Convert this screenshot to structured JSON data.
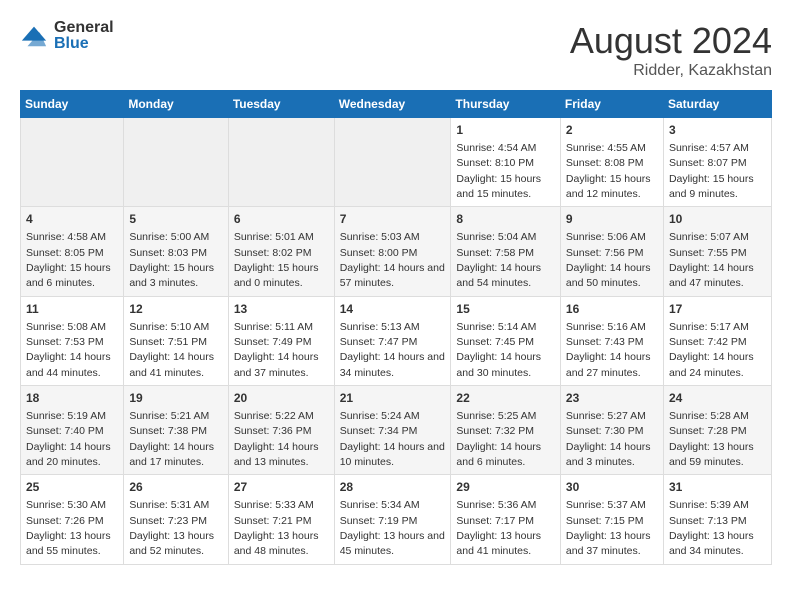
{
  "logo": {
    "general": "General",
    "blue": "Blue"
  },
  "title": {
    "month_year": "August 2024",
    "location": "Ridder, Kazakhstan"
  },
  "days_of_week": [
    "Sunday",
    "Monday",
    "Tuesday",
    "Wednesday",
    "Thursday",
    "Friday",
    "Saturday"
  ],
  "weeks": [
    [
      {
        "day": "",
        "sunrise": "",
        "sunset": "",
        "daylight": ""
      },
      {
        "day": "",
        "sunrise": "",
        "sunset": "",
        "daylight": ""
      },
      {
        "day": "",
        "sunrise": "",
        "sunset": "",
        "daylight": ""
      },
      {
        "day": "",
        "sunrise": "",
        "sunset": "",
        "daylight": ""
      },
      {
        "day": "1",
        "sunrise": "Sunrise: 4:54 AM",
        "sunset": "Sunset: 8:10 PM",
        "daylight": "Daylight: 15 hours and 15 minutes."
      },
      {
        "day": "2",
        "sunrise": "Sunrise: 4:55 AM",
        "sunset": "Sunset: 8:08 PM",
        "daylight": "Daylight: 15 hours and 12 minutes."
      },
      {
        "day": "3",
        "sunrise": "Sunrise: 4:57 AM",
        "sunset": "Sunset: 8:07 PM",
        "daylight": "Daylight: 15 hours and 9 minutes."
      }
    ],
    [
      {
        "day": "4",
        "sunrise": "Sunrise: 4:58 AM",
        "sunset": "Sunset: 8:05 PM",
        "daylight": "Daylight: 15 hours and 6 minutes."
      },
      {
        "day": "5",
        "sunrise": "Sunrise: 5:00 AM",
        "sunset": "Sunset: 8:03 PM",
        "daylight": "Daylight: 15 hours and 3 minutes."
      },
      {
        "day": "6",
        "sunrise": "Sunrise: 5:01 AM",
        "sunset": "Sunset: 8:02 PM",
        "daylight": "Daylight: 15 hours and 0 minutes."
      },
      {
        "day": "7",
        "sunrise": "Sunrise: 5:03 AM",
        "sunset": "Sunset: 8:00 PM",
        "daylight": "Daylight: 14 hours and 57 minutes."
      },
      {
        "day": "8",
        "sunrise": "Sunrise: 5:04 AM",
        "sunset": "Sunset: 7:58 PM",
        "daylight": "Daylight: 14 hours and 54 minutes."
      },
      {
        "day": "9",
        "sunrise": "Sunrise: 5:06 AM",
        "sunset": "Sunset: 7:56 PM",
        "daylight": "Daylight: 14 hours and 50 minutes."
      },
      {
        "day": "10",
        "sunrise": "Sunrise: 5:07 AM",
        "sunset": "Sunset: 7:55 PM",
        "daylight": "Daylight: 14 hours and 47 minutes."
      }
    ],
    [
      {
        "day": "11",
        "sunrise": "Sunrise: 5:08 AM",
        "sunset": "Sunset: 7:53 PM",
        "daylight": "Daylight: 14 hours and 44 minutes."
      },
      {
        "day": "12",
        "sunrise": "Sunrise: 5:10 AM",
        "sunset": "Sunset: 7:51 PM",
        "daylight": "Daylight: 14 hours and 41 minutes."
      },
      {
        "day": "13",
        "sunrise": "Sunrise: 5:11 AM",
        "sunset": "Sunset: 7:49 PM",
        "daylight": "Daylight: 14 hours and 37 minutes."
      },
      {
        "day": "14",
        "sunrise": "Sunrise: 5:13 AM",
        "sunset": "Sunset: 7:47 PM",
        "daylight": "Daylight: 14 hours and 34 minutes."
      },
      {
        "day": "15",
        "sunrise": "Sunrise: 5:14 AM",
        "sunset": "Sunset: 7:45 PM",
        "daylight": "Daylight: 14 hours and 30 minutes."
      },
      {
        "day": "16",
        "sunrise": "Sunrise: 5:16 AM",
        "sunset": "Sunset: 7:43 PM",
        "daylight": "Daylight: 14 hours and 27 minutes."
      },
      {
        "day": "17",
        "sunrise": "Sunrise: 5:17 AM",
        "sunset": "Sunset: 7:42 PM",
        "daylight": "Daylight: 14 hours and 24 minutes."
      }
    ],
    [
      {
        "day": "18",
        "sunrise": "Sunrise: 5:19 AM",
        "sunset": "Sunset: 7:40 PM",
        "daylight": "Daylight: 14 hours and 20 minutes."
      },
      {
        "day": "19",
        "sunrise": "Sunrise: 5:21 AM",
        "sunset": "Sunset: 7:38 PM",
        "daylight": "Daylight: 14 hours and 17 minutes."
      },
      {
        "day": "20",
        "sunrise": "Sunrise: 5:22 AM",
        "sunset": "Sunset: 7:36 PM",
        "daylight": "Daylight: 14 hours and 13 minutes."
      },
      {
        "day": "21",
        "sunrise": "Sunrise: 5:24 AM",
        "sunset": "Sunset: 7:34 PM",
        "daylight": "Daylight: 14 hours and 10 minutes."
      },
      {
        "day": "22",
        "sunrise": "Sunrise: 5:25 AM",
        "sunset": "Sunset: 7:32 PM",
        "daylight": "Daylight: 14 hours and 6 minutes."
      },
      {
        "day": "23",
        "sunrise": "Sunrise: 5:27 AM",
        "sunset": "Sunset: 7:30 PM",
        "daylight": "Daylight: 14 hours and 3 minutes."
      },
      {
        "day": "24",
        "sunrise": "Sunrise: 5:28 AM",
        "sunset": "Sunset: 7:28 PM",
        "daylight": "Daylight: 13 hours and 59 minutes."
      }
    ],
    [
      {
        "day": "25",
        "sunrise": "Sunrise: 5:30 AM",
        "sunset": "Sunset: 7:26 PM",
        "daylight": "Daylight: 13 hours and 55 minutes."
      },
      {
        "day": "26",
        "sunrise": "Sunrise: 5:31 AM",
        "sunset": "Sunset: 7:23 PM",
        "daylight": "Daylight: 13 hours and 52 minutes."
      },
      {
        "day": "27",
        "sunrise": "Sunrise: 5:33 AM",
        "sunset": "Sunset: 7:21 PM",
        "daylight": "Daylight: 13 hours and 48 minutes."
      },
      {
        "day": "28",
        "sunrise": "Sunrise: 5:34 AM",
        "sunset": "Sunset: 7:19 PM",
        "daylight": "Daylight: 13 hours and 45 minutes."
      },
      {
        "day": "29",
        "sunrise": "Sunrise: 5:36 AM",
        "sunset": "Sunset: 7:17 PM",
        "daylight": "Daylight: 13 hours and 41 minutes."
      },
      {
        "day": "30",
        "sunrise": "Sunrise: 5:37 AM",
        "sunset": "Sunset: 7:15 PM",
        "daylight": "Daylight: 13 hours and 37 minutes."
      },
      {
        "day": "31",
        "sunrise": "Sunrise: 5:39 AM",
        "sunset": "Sunset: 7:13 PM",
        "daylight": "Daylight: 13 hours and 34 minutes."
      }
    ]
  ]
}
